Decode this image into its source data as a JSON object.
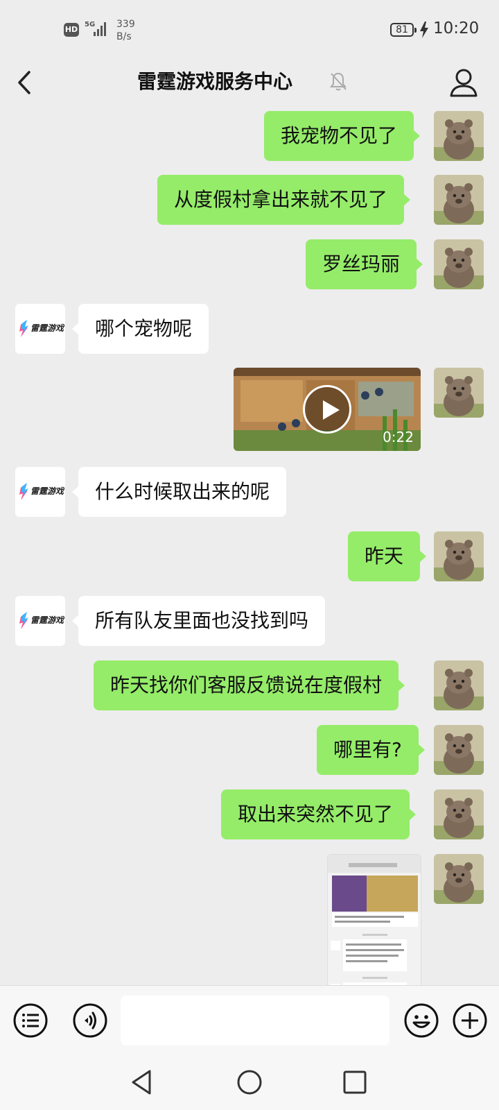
{
  "status_bar": {
    "hd": "HD",
    "network": "5G",
    "net_rate_value": "339",
    "net_rate_unit": "B/s",
    "battery": "81",
    "time": "10:20"
  },
  "header": {
    "title": "雷霆游戏服务中心",
    "back_icon": "chevron-left-icon",
    "mute_icon": "bell-off-icon",
    "profile_icon": "person-icon"
  },
  "game_avatar_text": "雷霆游戏",
  "messages": [
    {
      "side": "right",
      "type": "text",
      "text": "我宠物不见了"
    },
    {
      "side": "right",
      "type": "text",
      "text": "从度假村拿出来就不见了"
    },
    {
      "side": "right",
      "type": "text",
      "text": "罗丝玛丽"
    },
    {
      "side": "left",
      "type": "text",
      "text": "哪个宠物呢"
    },
    {
      "side": "right",
      "type": "video",
      "duration": "0:22"
    },
    {
      "side": "left",
      "type": "text",
      "text": "什么时候取出来的呢"
    },
    {
      "side": "right",
      "type": "text",
      "text": "昨天"
    },
    {
      "side": "left",
      "type": "text",
      "text": "所有队友里面也没找到吗"
    },
    {
      "side": "right",
      "type": "text",
      "text": "昨天找你们客服反馈说在度假村"
    },
    {
      "side": "right",
      "type": "text",
      "text": "哪里有?"
    },
    {
      "side": "right",
      "type": "text",
      "text": "取出来突然不见了"
    },
    {
      "side": "right",
      "type": "image"
    }
  ],
  "input_bar": {
    "menu_icon": "list-menu-icon",
    "voice_icon": "voice-icon",
    "emoji_icon": "emoji-icon",
    "add_icon": "plus-icon"
  },
  "nav_bar": {
    "back_icon": "triangle-back-icon",
    "home_icon": "circle-home-icon",
    "recent_icon": "square-recent-icon"
  },
  "colors": {
    "background": "#ededed",
    "bubble_self": "#95ec69",
    "bubble_other": "#ffffff"
  }
}
